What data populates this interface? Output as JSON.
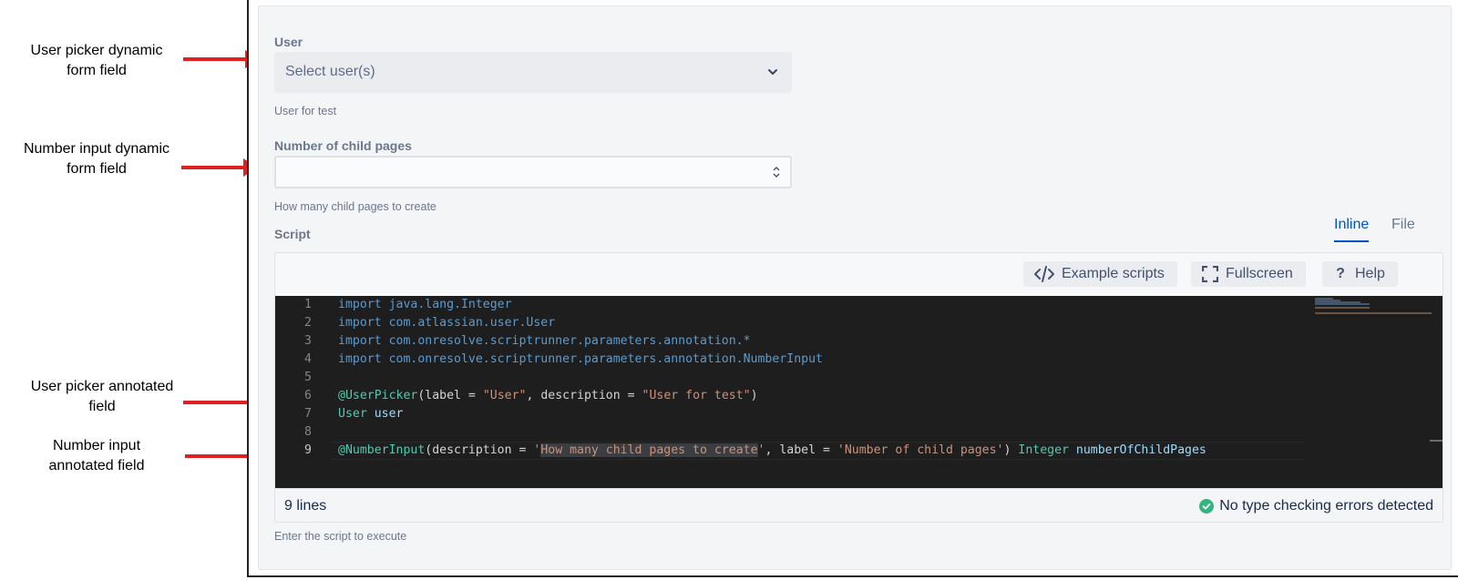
{
  "annotations": [
    {
      "id": "user-picker-dynamic",
      "lines": [
        "User picker dynamic",
        "form field"
      ]
    },
    {
      "id": "number-input-dynamic",
      "lines": [
        "Number input dynamic",
        "form field"
      ]
    },
    {
      "id": "user-picker-annotated",
      "lines": [
        "User picker annotated",
        "field"
      ]
    },
    {
      "id": "number-input-annotated",
      "lines": [
        "Number input",
        "annotated field"
      ]
    }
  ],
  "form": {
    "user_field": {
      "label": "User",
      "placeholder": "Select user(s)",
      "helper": "User for test"
    },
    "number_field": {
      "label": "Number of child pages",
      "value": "",
      "helper": "How many child pages to create"
    },
    "script_field": {
      "label": "Script",
      "helper": "Enter the script to execute"
    }
  },
  "tabs": [
    {
      "label": "Inline",
      "active": true
    },
    {
      "label": "File",
      "active": false
    }
  ],
  "toolbar": {
    "examples_label": "Example scripts",
    "fullscreen_label": "Fullscreen",
    "help_label": "Help"
  },
  "code": {
    "lines": [
      {
        "n": "1",
        "tokens": [
          {
            "t": "import java.lang.Integer",
            "c": "k"
          }
        ]
      },
      {
        "n": "2",
        "tokens": [
          {
            "t": "import com.atlassian.user.User",
            "c": "k"
          }
        ]
      },
      {
        "n": "3",
        "tokens": [
          {
            "t": "import com.onresolve.scriptrunner.parameters.annotation.*",
            "c": "k"
          }
        ]
      },
      {
        "n": "4",
        "tokens": [
          {
            "t": "import com.onresolve.scriptrunner.parameters.annotation.NumberInput",
            "c": "k"
          }
        ]
      },
      {
        "n": "5",
        "tokens": []
      },
      {
        "n": "6",
        "tokens": [
          {
            "t": "@UserPicker",
            "c": "ann"
          },
          {
            "t": "(label = ",
            "c": "plain"
          },
          {
            "t": "\"User\"",
            "c": "str"
          },
          {
            "t": ", description = ",
            "c": "plain"
          },
          {
            "t": "\"User for test\"",
            "c": "str"
          },
          {
            "t": ")",
            "c": "plain"
          }
        ]
      },
      {
        "n": "7",
        "tokens": [
          {
            "t": "User",
            "c": "ann"
          },
          {
            "t": " ",
            "c": "plain"
          },
          {
            "t": "user",
            "c": "var"
          }
        ]
      },
      {
        "n": "8",
        "tokens": []
      },
      {
        "n": "9",
        "active": true,
        "tokens": [
          {
            "t": "@NumberInput",
            "c": "ann"
          },
          {
            "t": "(description = ",
            "c": "plain"
          },
          {
            "t": "'",
            "c": "str"
          },
          {
            "t": "How many child pages to create",
            "c": "str hl"
          },
          {
            "t": "'",
            "c": "str"
          },
          {
            "t": ", label = ",
            "c": "plain"
          },
          {
            "t": "'Number of child pages'",
            "c": "str"
          },
          {
            "t": ") ",
            "c": "plain"
          },
          {
            "t": "Integer",
            "c": "ann"
          },
          {
            "t": " ",
            "c": "plain"
          },
          {
            "t": "numberOfChildPages",
            "c": "var"
          }
        ]
      }
    ]
  },
  "status": {
    "line_count": "9 lines",
    "type_check": "No type checking errors detected"
  },
  "colors": {
    "arrow": "#e02020",
    "accent": "#0052cc",
    "success": "#36b37e",
    "editor_bg": "#1e1e1e"
  },
  "icons": [
    "chevron-down-icon",
    "spinner-arrows-icon",
    "code-icon",
    "fullscreen-icon",
    "help-icon",
    "check-circle-icon"
  ]
}
